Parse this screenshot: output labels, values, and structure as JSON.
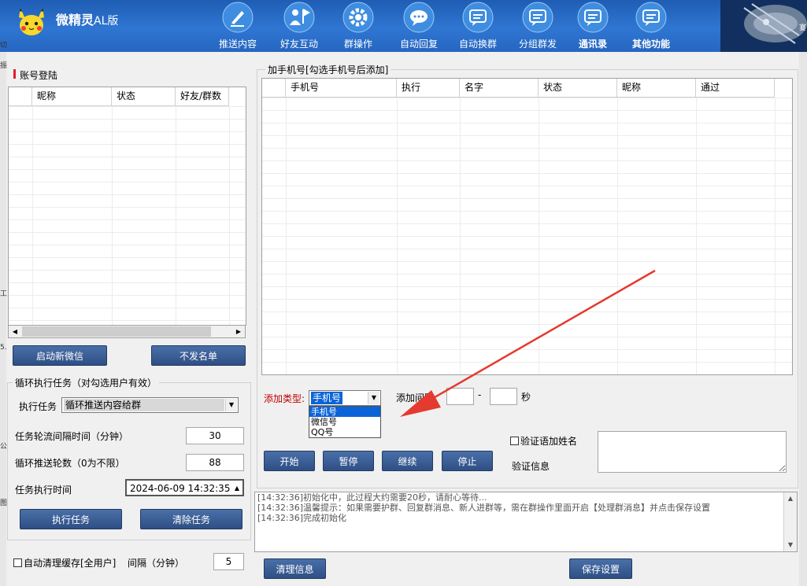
{
  "header": {
    "title": "微精灵",
    "title_suffix": "AL版",
    "nav": [
      {
        "label": "推送内容",
        "icon": "pen-icon"
      },
      {
        "label": "好友互动",
        "icon": "user-flag-icon"
      },
      {
        "label": "群操作",
        "icon": "gear-icon"
      },
      {
        "label": "自动回复",
        "icon": "chat-dots-icon"
      },
      {
        "label": "自动换群",
        "icon": "chat-lines-icon"
      },
      {
        "label": "分组群发",
        "icon": "chat-lines-icon"
      },
      {
        "label": "通讯录",
        "icon": "chat-lines-icon"
      },
      {
        "label": "其他功能",
        "icon": "chat-lines-icon"
      }
    ]
  },
  "left_edge": {
    "c1": "切",
    "c2": "振",
    "c3": "5.",
    "c4": "公",
    "c5": "图",
    "c6": "工]",
    "r1": "宴"
  },
  "account": {
    "title": "账号登陆",
    "columns": [
      "昵称",
      "状态",
      "好友/群数"
    ],
    "start_button": "启动新微信",
    "blacklist_button": "不发名单"
  },
  "loop_task": {
    "title": "循环执行任务（对勾选用户有效）",
    "task_label": "执行任务",
    "task_value": "循环推送内容给群",
    "interval_label": "任务轮流间隔时间（分钟）",
    "interval_value": "30",
    "rounds_label": "循环推送轮数（0为不限）",
    "rounds_value": "88",
    "time_label": "任务执行时间",
    "time_value": "2024-06-09 14:32:35",
    "run_button": "执行任务",
    "clear_button": "清除任务"
  },
  "cache": {
    "label": "自动清理缓存[全用户]",
    "interval_label": "间隔（分钟）",
    "interval_value": "5"
  },
  "phone": {
    "title": "加手机号[勾选手机号后添加]",
    "columns": [
      "手机号",
      "执行",
      "名字",
      "状态",
      "昵称",
      "通过"
    ],
    "type_label": "添加类型:",
    "type_value": "手机号",
    "type_options": [
      "手机号",
      "微信号",
      "QQ号"
    ],
    "interval_label": "添加间隔",
    "dash": "-",
    "unit": "秒",
    "verify_name_label": "验证语加姓名",
    "verify_info_label": "验证信息",
    "buttons": {
      "start": "开始",
      "pause": "暂停",
      "resume": "继续",
      "stop": "停止"
    }
  },
  "log": {
    "lines": [
      "[14:32:36]初始化中，此过程大约需要20秒，请耐心等待...",
      "[14:32:36]温馨提示：如果需要护群、回复群消息、新人进群等，需在群操作里面开启【处理群消息】并点击保存设置",
      "[14:32:36]完成初始化"
    ]
  },
  "bottom": {
    "clear_log": "清理信息",
    "save_settings": "保存设置"
  },
  "colors": {
    "accent": "#2e4f85",
    "header": "#2566c0",
    "arrow": "#e53a2f",
    "selected": "#0a64d8"
  }
}
